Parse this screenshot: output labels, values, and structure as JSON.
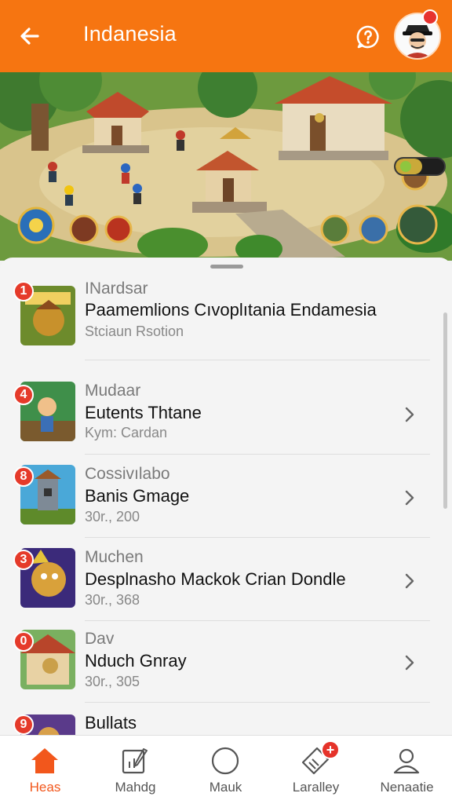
{
  "header": {
    "title": "Indanesia",
    "back_icon": "arrow-left-icon",
    "help_icon": "question-chat-icon",
    "accent": "#f67511"
  },
  "banner": {
    "progress_fraction": 0.55
  },
  "list": {
    "items": [
      {
        "rank": "1",
        "category": "INardsar",
        "name": "Paamemlions Cıvoplıtania Endamesia",
        "meta": "Stciaun Rsotion"
      },
      {
        "rank": "4",
        "category": "Mudaar",
        "name": "Eutents Thtane",
        "meta": "Kym: Cardan"
      },
      {
        "rank": "8",
        "category": "Cossivılabo",
        "name": "Banis Gmage",
        "meta": "30r., 200"
      },
      {
        "rank": "3",
        "category": "Muchen",
        "name": "Desplnasho Mackok Crian Dondle",
        "meta": "30r., 368"
      },
      {
        "rank": "0",
        "category": "Dav",
        "name": "Nduch Gnray",
        "meta": "30r., 305"
      },
      {
        "rank": "9",
        "category": "Bullats",
        "name": "",
        "meta": ""
      }
    ]
  },
  "nav": {
    "items": [
      {
        "label": "Heas",
        "icon": "home-icon"
      },
      {
        "label": "Mahdg",
        "icon": "note-edit-icon"
      },
      {
        "label": "Mauk",
        "icon": "circle-icon"
      },
      {
        "label": "Laralley",
        "icon": "tag-icon",
        "badge": "+"
      },
      {
        "label": "Nenaatie",
        "icon": "person-icon"
      }
    ],
    "active_color": "#f2571c"
  }
}
